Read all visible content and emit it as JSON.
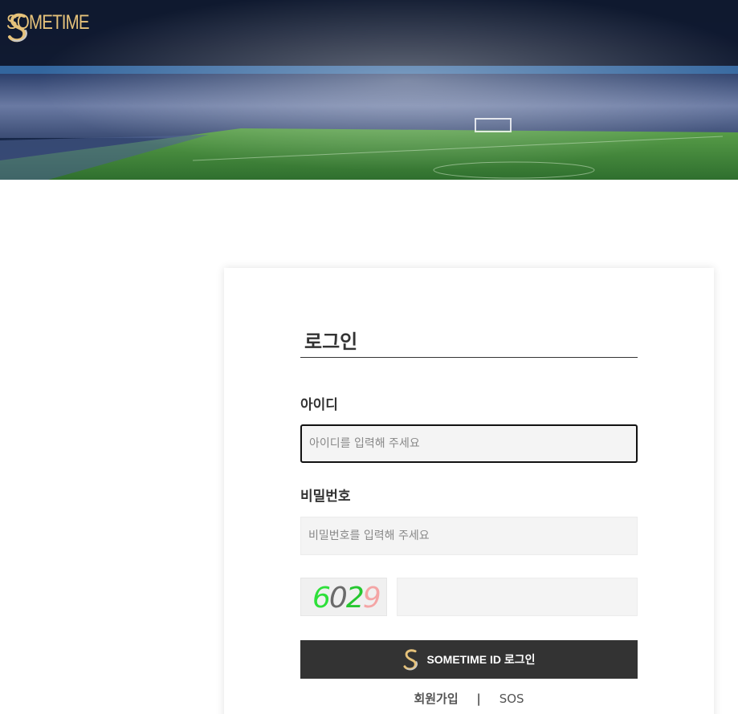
{
  "header": {
    "logo_text": "SOMETIME",
    "colors": {
      "logo_gold": "#e6c27a",
      "banner_dark": "#0b1a33",
      "pitch_green": "#3f8a3a"
    }
  },
  "login": {
    "title": "로그인",
    "id_label": "아이디",
    "id_placeholder": "아이디를 입력해 주세요",
    "pw_label": "비밀번호",
    "pw_placeholder": "비밀번호를 입력해 주세요",
    "captcha": {
      "digits": [
        "6",
        "0",
        "2",
        "9"
      ],
      "digit_colors": [
        "#2ee03a",
        "#6a6a6a",
        "#25c72f",
        "#f4a5a5"
      ],
      "input_placeholder": ""
    },
    "submit_label": "SOMETIME ID 로그인",
    "submit_bg": "#333333"
  },
  "footer_links": {
    "signup": "회원가입",
    "separator": "|",
    "sos": "SOS"
  }
}
